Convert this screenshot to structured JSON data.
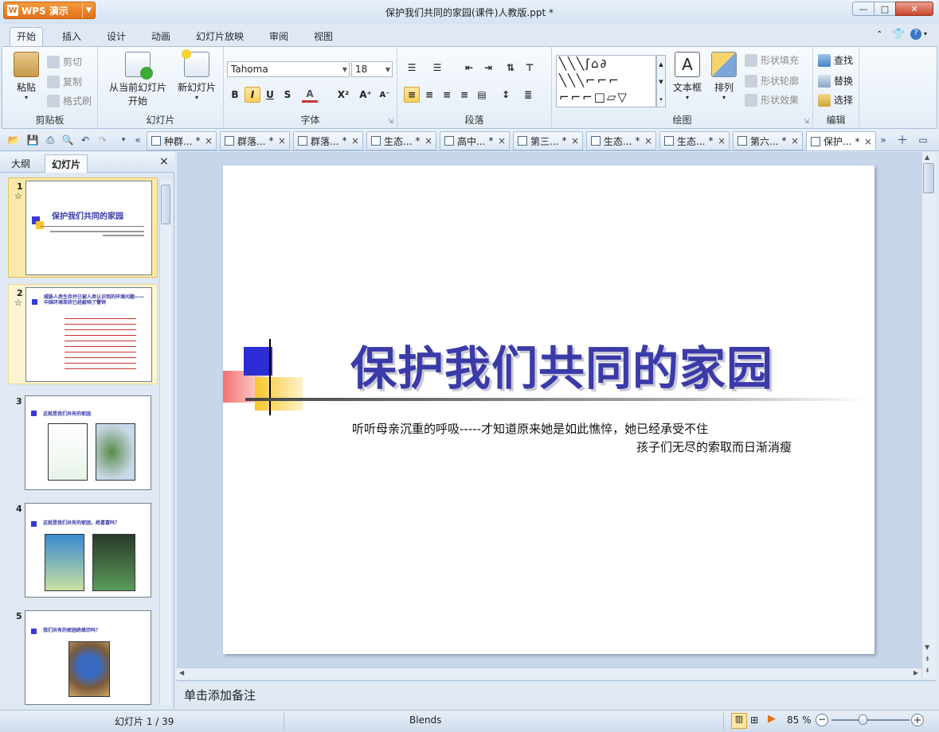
{
  "window": {
    "app_button": "WPS 演示",
    "title": "保护我们共同的家园(课件)人教版.ppt *",
    "min": "—",
    "max": "□",
    "close": "✕"
  },
  "menu": {
    "items": [
      "开始",
      "插入",
      "设计",
      "动画",
      "幻灯片放映",
      "审阅",
      "视图"
    ],
    "active": "开始"
  },
  "ribbon": {
    "clipboard": {
      "paste": "粘贴",
      "cut": "剪切",
      "copy": "复制",
      "format_painter": "格式刷",
      "label": "剪贴板"
    },
    "slides": {
      "from_current": "从当前幻灯片",
      "start": "开始",
      "new_slide": "新幻灯片",
      "label": "幻灯片"
    },
    "font": {
      "name": "Tahoma",
      "size": "18",
      "label": "字体",
      "bold": "B",
      "italic": "I",
      "underline": "U",
      "shadow": "S",
      "color": "A",
      "superscript": "X²",
      "grow": "A⁺",
      "shrink": "A⁻"
    },
    "paragraph": {
      "label": "段落"
    },
    "drawing": {
      "textbox": "文本框",
      "arrange": "排列",
      "shape_fill": "形状填充",
      "shape_outline": "形状轮廓",
      "shape_effect": "形状效果",
      "label": "绘图"
    },
    "edit": {
      "find": "查找",
      "replace": "替换",
      "select": "选择",
      "label": "编辑"
    }
  },
  "doc_tabs": [
    "种群...",
    "群落...",
    "群落...",
    "生态...",
    "高中...",
    "第三...",
    "生态...",
    "生态...",
    "第六...",
    "保护..."
  ],
  "left_pane": {
    "tab_outline": "大纲",
    "tab_slides": "幻灯片",
    "close": "×",
    "thumbs": [
      {
        "num": "1",
        "title": "保护我们共同的家园"
      },
      {
        "num": "2",
        "title": "威胁人类生存并已被人类认识到的环境问题——中国环境现状已经敲响了警钟"
      },
      {
        "num": "3",
        "title": "这就是我们共有的家园"
      },
      {
        "num": "4",
        "title": "这就是我们共有的家园，绝喜富吗？"
      },
      {
        "num": "5",
        "title": "我们共有的家园绝缘宗吗？"
      }
    ]
  },
  "slide": {
    "title": "保护我们共同的家园",
    "subtitle_line1": "听听母亲沉重的呼吸-----才知道原来她是如此憔悴，她已经承受不住",
    "subtitle_line2": "孩子们无尽的索取而日渐消瘦"
  },
  "notes_placeholder": "单击添加备注",
  "status": {
    "slide_counter": "幻灯片 1 / 39",
    "theme": "Blends",
    "zoom": "85 %"
  },
  "colors": {
    "accent_orange": "#e2711b",
    "slide_title_blue": "#3a3aa8",
    "ribbon_bg": "#e4edf7"
  }
}
